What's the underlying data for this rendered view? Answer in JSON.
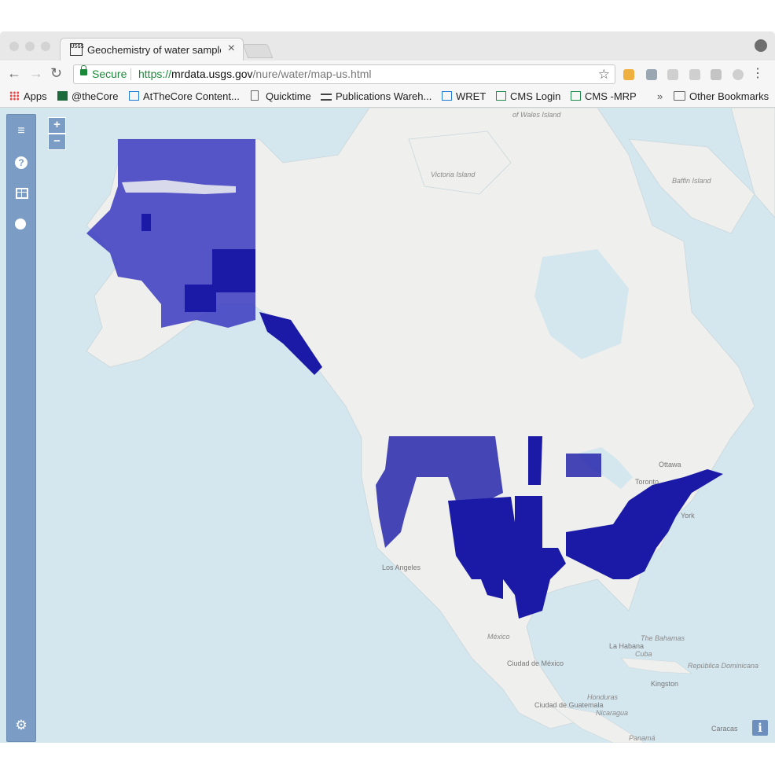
{
  "browser": {
    "tab_title": "Geochemistry of water samples",
    "tab_favicon": "USGS",
    "secure_label": "Secure",
    "url_scheme": "https://",
    "url_host": "mrdata.usgs.gov",
    "url_path": "/nure/water/map-us.html"
  },
  "bookmarks": {
    "items": [
      {
        "label": "Apps",
        "icon": "apps-grid-icon"
      },
      {
        "label": "@theCore",
        "icon": "core-icon"
      },
      {
        "label": "AtTheCore Content...",
        "icon": "page-layout-icon"
      },
      {
        "label": "Quicktime",
        "icon": "document-icon"
      },
      {
        "label": "Publications Wareh...",
        "icon": "usgs-wave-icon"
      },
      {
        "label": "WRET",
        "icon": "page-layout-icon"
      },
      {
        "label": "CMS Login",
        "icon": "cms-icon"
      },
      {
        "label": "CMS -MRP",
        "icon": "cms-icon"
      }
    ],
    "overflow": "»",
    "other": "Other Bookmarks"
  },
  "map": {
    "zoom_in": "+",
    "zoom_out": "−",
    "info": "i",
    "sample_color": "#1a1aa6",
    "labels": {
      "victoria": "Victoria Island",
      "baffin": "Baffin Island",
      "wales": "of Wales Island",
      "ottawa": "Ottawa",
      "toronto": "Toronto",
      "newyork": "York",
      "losangeles": "Los Angeles",
      "mexico": "México",
      "ciudad_de_mexico": "Ciudad de México",
      "bahamas": "The Bahamas",
      "habana": "La Habana",
      "cuba": "Cuba",
      "republica": "República Dominicana",
      "kingston": "Kingston",
      "honduras": "Honduras",
      "guatemala": "Ciudad de Guatemala",
      "nicaragua": "Nicaragua",
      "caracas": "Caracas",
      "panama": "Panamá"
    }
  },
  "sidebar": {
    "icons": [
      "menu-icon",
      "help-icon",
      "table-icon",
      "globe-icon",
      "settings-icon"
    ]
  }
}
